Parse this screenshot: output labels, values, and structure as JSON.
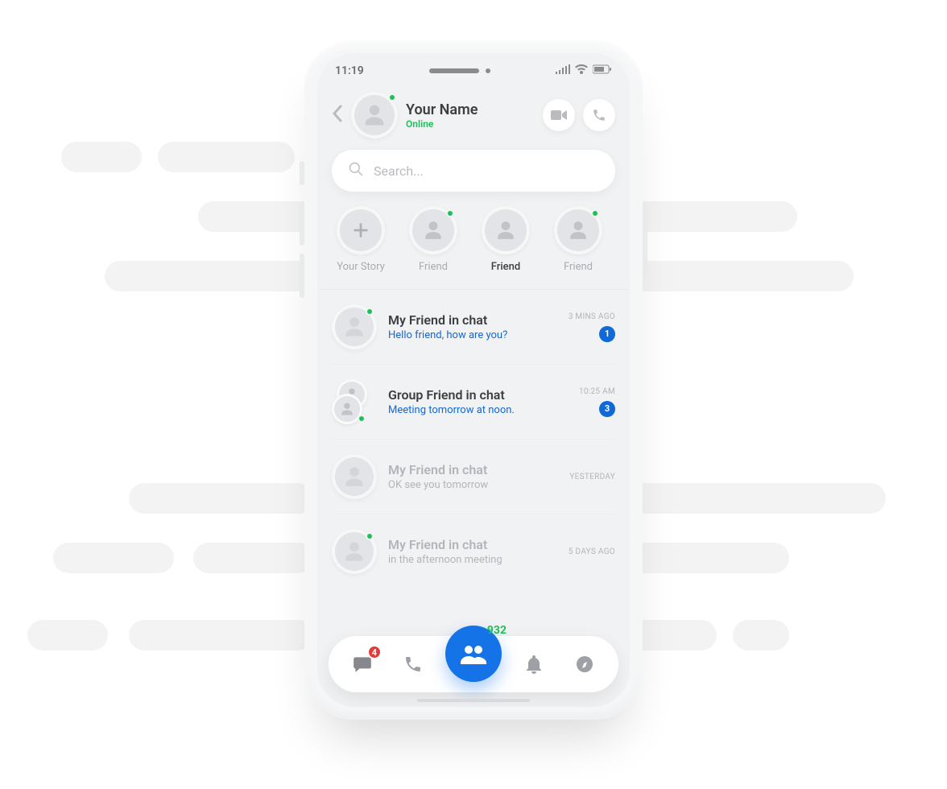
{
  "statusbar": {
    "time": "11:19"
  },
  "header": {
    "name": "Your Name",
    "status": "Online"
  },
  "search": {
    "placeholder": "Search..."
  },
  "stories": [
    {
      "label": "Your Story",
      "type": "add",
      "online": false,
      "active": false
    },
    {
      "label": "Friend",
      "type": "friend",
      "online": true,
      "active": false
    },
    {
      "label": "Friend",
      "type": "friend",
      "online": false,
      "active": true
    },
    {
      "label": "Friend",
      "type": "friend",
      "online": true,
      "active": false
    }
  ],
  "chats": [
    {
      "title": "My Friend in chat",
      "message": "Hello friend, how are you?",
      "time": "3 MINS AGO",
      "unread": 1,
      "online": true,
      "group": false,
      "muted": false
    },
    {
      "title": "Group Friend in chat",
      "message": "Meeting tomorrow at noon.",
      "time": "10:25 AM",
      "unread": 3,
      "online": true,
      "group": true,
      "muted": false
    },
    {
      "title": "My Friend in chat",
      "message": "OK see you tomorrow",
      "time": "YESTERDAY",
      "unread": 0,
      "online": false,
      "group": false,
      "muted": true
    },
    {
      "title": "My Friend in chat",
      "message": "in the afternoon meeting",
      "time": "5 DAYS AGO",
      "unread": 0,
      "online": true,
      "group": false,
      "muted": true
    }
  ],
  "bottomnav": {
    "chat_badge": "4",
    "center_count": "932"
  }
}
